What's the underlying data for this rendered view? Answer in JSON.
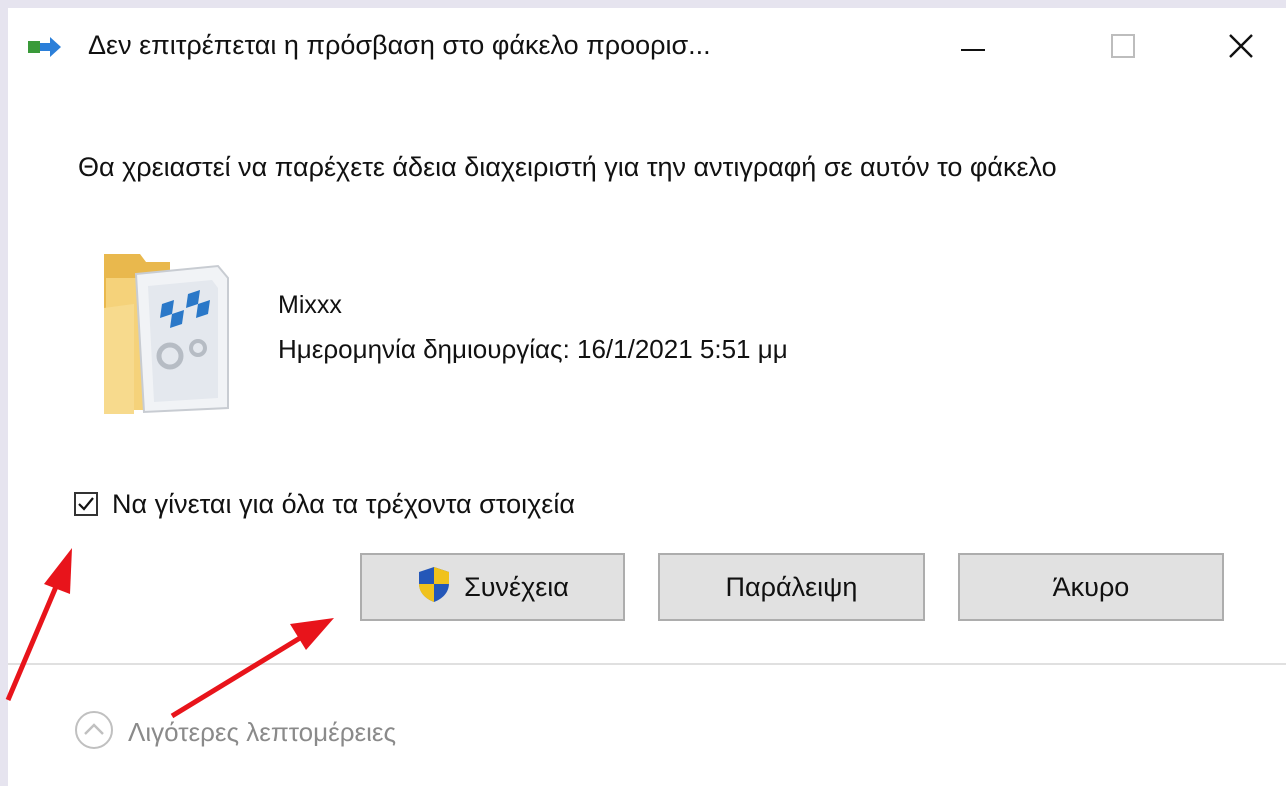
{
  "window": {
    "title": "Δεν επιτρέπεται η πρόσβαση στο φάκελο προορισ...",
    "title_icon": "file-move-icon",
    "controls": {
      "minimize": "minimize-icon",
      "maximize": "maximize-icon",
      "close": "close-icon"
    }
  },
  "dialog": {
    "message": "Θα χρειαστεί να παρέχετε άδεια διαχειριστή για την αντιγραφή σε αυτόν το φάκελο",
    "item": {
      "icon": "folder-settings-icon",
      "name": "Mixxx",
      "created": "Ημερομηνία δημιουργίας: 16/1/2021 5:51 μμ"
    },
    "checkbox": {
      "label": "Να γίνεται για όλα τα τρέχοντα στοιχεία",
      "checked": true
    },
    "buttons": {
      "continue": "Συνέχεια",
      "skip": "Παράλειψη",
      "cancel": "Άκυρο"
    },
    "details_toggle": "Λιγότερες λεπτομέρειες"
  },
  "colors": {
    "annotation_arrow": "#e8141b",
    "button_bg": "#e1e1e1",
    "button_border": "#adadad",
    "window_bg": "#ffffff",
    "backdrop": "#e6e4ef"
  }
}
